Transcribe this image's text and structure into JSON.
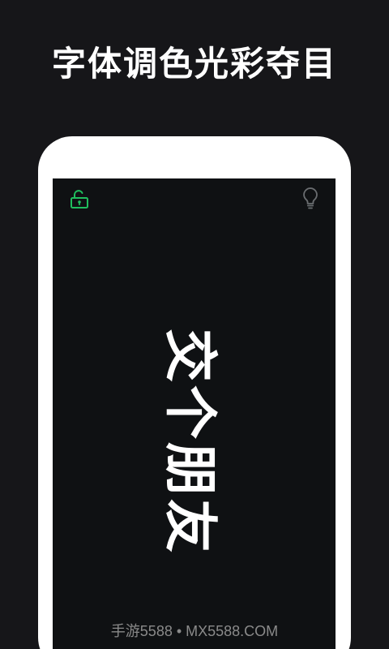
{
  "header": {
    "title": "字体调色光彩夺目"
  },
  "screen": {
    "display_text": "交个朋友",
    "lock_icon": "unlocked-padlock-icon",
    "lock_color": "#1fbf5e",
    "bulb_icon": "lightbulb-icon",
    "bulb_color": "#6a6d70"
  },
  "watermark": {
    "text": "手游5588 • MX5588.COM"
  }
}
